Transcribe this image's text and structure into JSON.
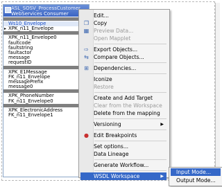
{
  "transformation": {
    "title_line1": "ASL_SOSV_ProcessCustomer",
    "title_line2": "WebServices Consumer",
    "rows": [
      {
        "kind": "hdr",
        "text": ""
      },
      {
        "kind": "sel",
        "text": "Ws10_Envelope"
      },
      {
        "kind": "ptr",
        "text": "XPK_n11_Envelope"
      },
      {
        "kind": "hdr",
        "text": ""
      },
      {
        "kind": "txt",
        "text": "XPK_n11_Envelope0"
      },
      {
        "kind": "txt",
        "text": "faultcode"
      },
      {
        "kind": "txt",
        "text": "faultstring"
      },
      {
        "kind": "txt",
        "text": "faultactor"
      },
      {
        "kind": "txt",
        "text": "message"
      },
      {
        "kind": "txt",
        "text": "requestID"
      },
      {
        "kind": "hdr",
        "text": ""
      },
      {
        "kind": "txt",
        "text": "XPK_E1Message"
      },
      {
        "kind": "txt",
        "text": "FK_n11_Envelope"
      },
      {
        "kind": "txt",
        "text": "messagePrefix"
      },
      {
        "kind": "txt",
        "text": "message0"
      },
      {
        "kind": "hdr",
        "text": ""
      },
      {
        "kind": "txt",
        "text": "XPK_PhoneNumber"
      },
      {
        "kind": "txt",
        "text": "FK_n11_Envelope0"
      },
      {
        "kind": "hdr",
        "text": ""
      },
      {
        "kind": "txt",
        "text": "XPK_ElectronicAddress"
      },
      {
        "kind": "txt",
        "text": "FK_n11_Envelope1"
      }
    ]
  },
  "menu": {
    "items": [
      {
        "label": "Edit...",
        "icon": "",
        "disabled": false
      },
      {
        "label": "Copy",
        "icon": "copy-icon",
        "disabled": false
      },
      {
        "label": "Preview Data...",
        "icon": "preview-icon",
        "disabled": true
      },
      {
        "label": "Open Mapplet",
        "icon": "",
        "disabled": true
      },
      {
        "sep": true
      },
      {
        "label": "Export Objects...",
        "icon": "export-icon",
        "disabled": false
      },
      {
        "label": "Compare Objects...",
        "icon": "compare-icon",
        "disabled": false
      },
      {
        "sep": true
      },
      {
        "label": "Dependencies...",
        "icon": "dependencies-icon",
        "disabled": false
      },
      {
        "sep": true
      },
      {
        "label": "Iconize",
        "icon": "",
        "disabled": false
      },
      {
        "label": "Restore",
        "icon": "",
        "disabled": true
      },
      {
        "sep": true
      },
      {
        "label": "Create and Add Target",
        "icon": "",
        "disabled": false
      },
      {
        "label": "Clear from the Workspace",
        "icon": "",
        "disabled": true
      },
      {
        "label": "Delete from the mapping",
        "icon": "",
        "disabled": false
      },
      {
        "sep": true
      },
      {
        "label": "Versioning",
        "icon": "",
        "disabled": false,
        "submenu": true
      },
      {
        "sep": true
      },
      {
        "label": "Edit Breakpoints",
        "icon": "breakpoint-icon",
        "disabled": false
      },
      {
        "sep": true
      },
      {
        "label": "Set options...",
        "icon": "",
        "disabled": false
      },
      {
        "label": "Data Lineage",
        "icon": "",
        "disabled": false
      },
      {
        "sep": true
      },
      {
        "label": "Generate Workflow...",
        "icon": "",
        "disabled": false
      },
      {
        "sep": true
      },
      {
        "label": "WSDL Workspace",
        "icon": "",
        "disabled": false,
        "submenu": true,
        "highlight": true
      }
    ]
  },
  "submenu": {
    "items": [
      {
        "label": "Input Mode...",
        "highlight": true
      },
      {
        "label": "Output Mode...",
        "highlight": false
      }
    ]
  },
  "colors": {
    "highlight": "#3568c8",
    "title_bar": "#3a64c4"
  }
}
